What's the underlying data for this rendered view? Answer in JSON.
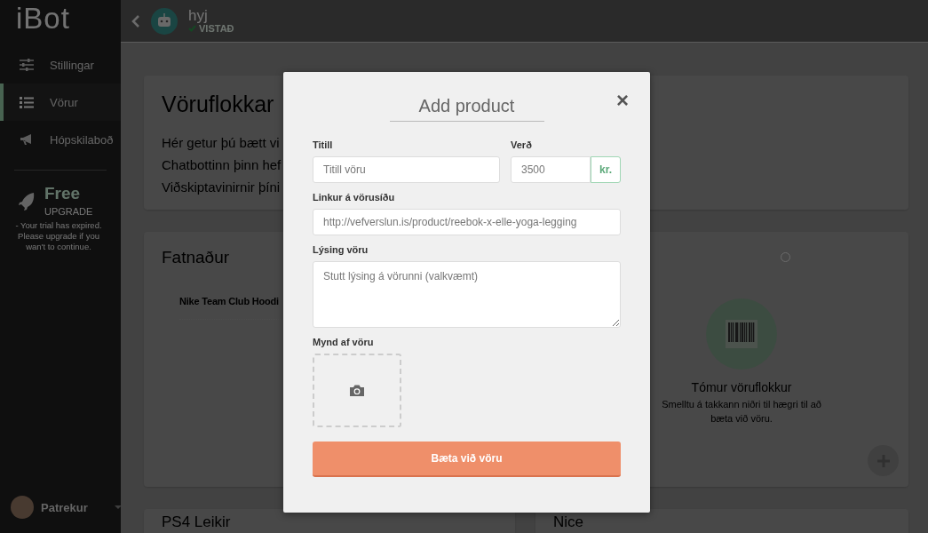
{
  "sidebar": {
    "logo": "iBot",
    "items": [
      {
        "label": "Stillingar",
        "selected": false
      },
      {
        "label": "Vörur",
        "selected": true
      },
      {
        "label": "Hópskilaboð",
        "selected": false
      }
    ],
    "plan": {
      "name": "Free",
      "action": "UPGRADE",
      "message": "- Your trial has expired. Please upgrade if you wan't to continue."
    },
    "user": {
      "name": "Patrekur"
    }
  },
  "header": {
    "bot_name": "hyj",
    "status": "VISTAÐ"
  },
  "intro_card": {
    "title": "Vöruflokkar",
    "lines": [
      "Hér getur þú bætt vi",
      "Chatbottinn þinn hef",
      "Viðskiptavinirnir þíni"
    ]
  },
  "categories": [
    {
      "kind": "list",
      "title": "Fatnaður",
      "products": [
        "Nike Team Club Hoodi"
      ]
    },
    {
      "kind": "empty",
      "selected": false,
      "empty_title": "Tómur vöruflokkur",
      "empty_text": "Smelltu á takkann niðri til hægri til að bæta við vöru."
    },
    {
      "kind": "list",
      "title": "PS4 Leikir"
    },
    {
      "kind": "list",
      "title": "Nice"
    }
  ],
  "modal": {
    "title": "Add product",
    "close": "×",
    "fields": [
      {
        "kind": "text",
        "label": "Titill",
        "placeholder": "Titill vöru"
      },
      {
        "kind": "price",
        "label": "Verð",
        "placeholder": "3500",
        "unit": "kr."
      },
      {
        "kind": "text",
        "label": "Linkur á vörusíðu",
        "placeholder": "http://vefverslun.is/product/reebok-x-elle-yoga-legging"
      },
      {
        "kind": "textarea",
        "label": "Lýsing vöru",
        "placeholder": "Stutt lýsing á vörunni (valkvæmt)"
      },
      {
        "kind": "image",
        "label": "Mynd af vöru"
      }
    ],
    "submit": "Bæta við vöru"
  }
}
